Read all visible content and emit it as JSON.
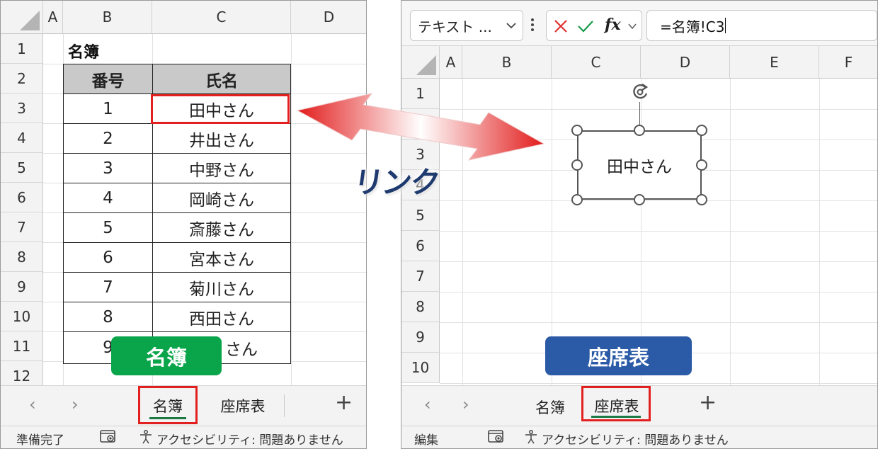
{
  "left_window": {
    "columns": [
      "A",
      "B",
      "C",
      "D"
    ],
    "rows": [
      "1",
      "2",
      "3",
      "4",
      "5",
      "6",
      "7",
      "8",
      "9",
      "10",
      "11",
      "12"
    ],
    "sheet_title": "名簿",
    "table": {
      "headers": [
        "番号",
        "氏名"
      ],
      "rows": [
        [
          "1",
          "田中さん"
        ],
        [
          "2",
          "井出さん"
        ],
        [
          "3",
          "中野さん"
        ],
        [
          "4",
          "岡崎さん"
        ],
        [
          "5",
          "斎藤さん"
        ],
        [
          "6",
          "宮本さん"
        ],
        [
          "7",
          "菊川さん"
        ],
        [
          "8",
          "西田さん"
        ],
        [
          "9",
          "さん"
        ]
      ]
    },
    "tabs": [
      "名簿",
      "座席表"
    ],
    "active_tab": "名簿",
    "nav_prev": "‹",
    "nav_next": "›",
    "add_sheet": "+",
    "status": {
      "mode": "準備完了",
      "accessibility": "アクセシビリティ: 問題ありません"
    }
  },
  "right_window": {
    "name_box": "テキスト ...",
    "formula": "=名簿!C3",
    "columns": [
      "A",
      "B",
      "C",
      "D",
      "E",
      "F"
    ],
    "rows": [
      "1",
      "2",
      "3",
      "4",
      "5",
      "6",
      "7",
      "8",
      "9",
      "10"
    ],
    "shape_text": "田中さん",
    "tabs": [
      "名簿",
      "座席表"
    ],
    "active_tab": "座席表",
    "nav_prev": "‹",
    "nav_next": "›",
    "add_sheet": "+",
    "status": {
      "mode": "編集",
      "accessibility": "アクセシビリティ: 問題ありません"
    }
  },
  "overlays": {
    "link_label": "リンク",
    "left_label": "名簿",
    "right_label": "座席表"
  },
  "colors": {
    "green_label": "#0aa54a",
    "blue_label": "#2b5aa6",
    "highlight_red": "#e32020",
    "table_header_gray": "#c9c9c9"
  }
}
